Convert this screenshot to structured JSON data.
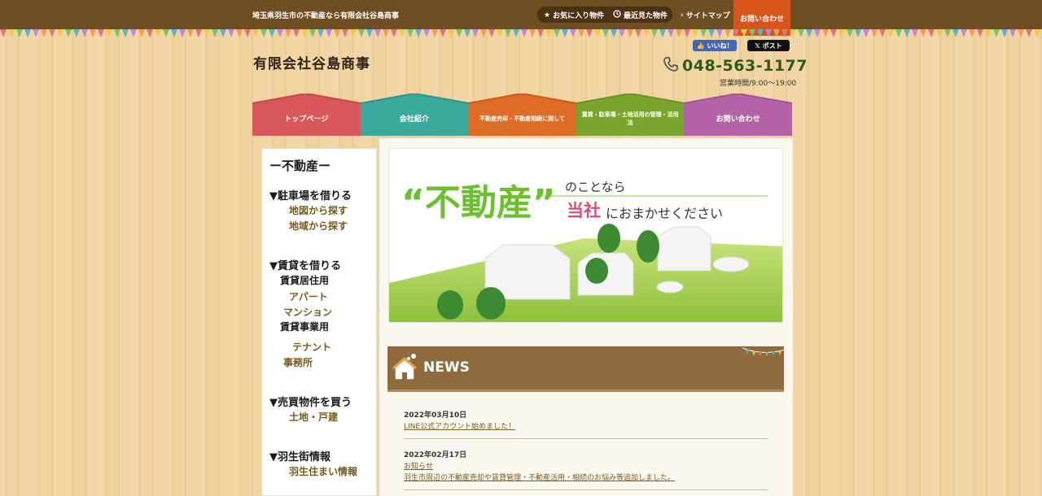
{
  "topbar": {
    "tagline": "埼玉県羽生市の不動産なら有限会社谷島商事",
    "favorites_label": "お気に入り物件",
    "recent_label": "最近見た物件",
    "sitemap_label": "サイトマップ",
    "contact_label": "お問い合わせ"
  },
  "header": {
    "company_name": "有限会社谷島商事",
    "like_label": "いいね！",
    "post_label": "ポスト",
    "phone": "048-563-1177",
    "hours": "営業時間/9:00〜19:00"
  },
  "nav": [
    {
      "label": "トップページ",
      "color": "#d9575a"
    },
    {
      "label": "会社紹介",
      "color": "#3aaa9e"
    },
    {
      "label": "不動産売却・不動産相続に関して",
      "color": "#de6b26"
    },
    {
      "label": "賃貸・駐車場・土地活用の管理・活用法",
      "color": "#7aa52c"
    },
    {
      "label": "お問い合わせ",
      "color": "#b463a8"
    }
  ],
  "sidebar": {
    "title": "ー不動産ー",
    "sections": [
      {
        "heading": "▼駐車場を借りる",
        "links": [
          "地図から探す",
          "地域から探す"
        ]
      },
      {
        "heading": "▼賃貸を借りる",
        "sub": [
          "賃貸居住用",
          "賃貸事業用"
        ],
        "links": [
          "アパート",
          "マンション",
          "テナント",
          "事務所"
        ]
      },
      {
        "heading": "▼売買物件を買う",
        "links": [
          "土地・戸建"
        ]
      },
      {
        "heading": "▼羽生街情報",
        "links": [
          "羽生住まい情報"
        ]
      }
    ]
  },
  "hero": {
    "quote_word": "“不動産”",
    "line1_suffix": "のことなら",
    "line2_highlight": "当社",
    "line2_rest": "におまかせください"
  },
  "news": {
    "title": "NEWS",
    "items": [
      {
        "date": "2022年03月10日",
        "lines": [
          "LINE公式アカウント始めました！"
        ]
      },
      {
        "date": "2022年02月17日",
        "lines": [
          "お知らせ",
          "羽生市周辺の不動産売却や賃貸管理・不動産活用・相続のお悩み等追加しました。"
        ]
      }
    ]
  },
  "colors": {
    "topbar": "#6e4e22",
    "contact_tab": "#d7541b",
    "phone": "#2e5a1c",
    "news_header": "#8e6a3c",
    "hero_green": "#6cbf2e",
    "hero_pink": "#d6507a"
  }
}
